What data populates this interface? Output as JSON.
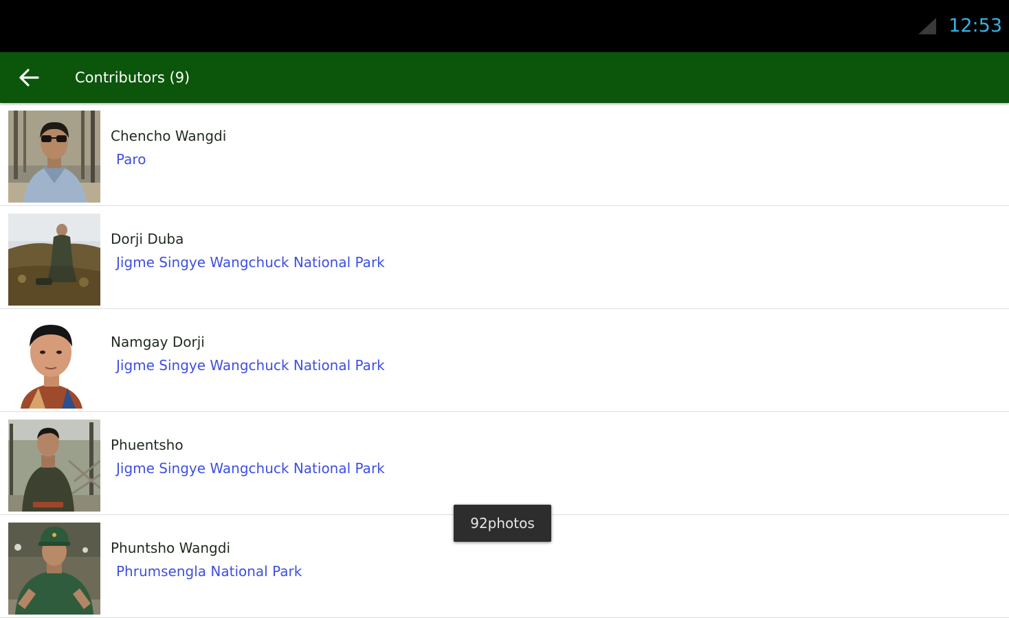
{
  "status_bar": {
    "time": "12:53",
    "signal_icon": "signal-icon",
    "time_color": "#33b5e5"
  },
  "action_bar": {
    "back_icon": "back-arrow-icon",
    "title": "Contributors (9)",
    "color": "#0c560b"
  },
  "contributors": [
    {
      "name": "Chencho Wangdi",
      "place": "Paro"
    },
    {
      "name": "Dorji Duba",
      "place": "Jigme Singye Wangchuck National Park"
    },
    {
      "name": "Namgay Dorji",
      "place": "Jigme Singye Wangchuck National Park"
    },
    {
      "name": "Phuentsho",
      "place": "Jigme Singye Wangchuck National Park"
    },
    {
      "name": "Phuntsho Wangdi",
      "place": "Phrumsengla National Park"
    }
  ],
  "toast": {
    "text": "92photos"
  }
}
